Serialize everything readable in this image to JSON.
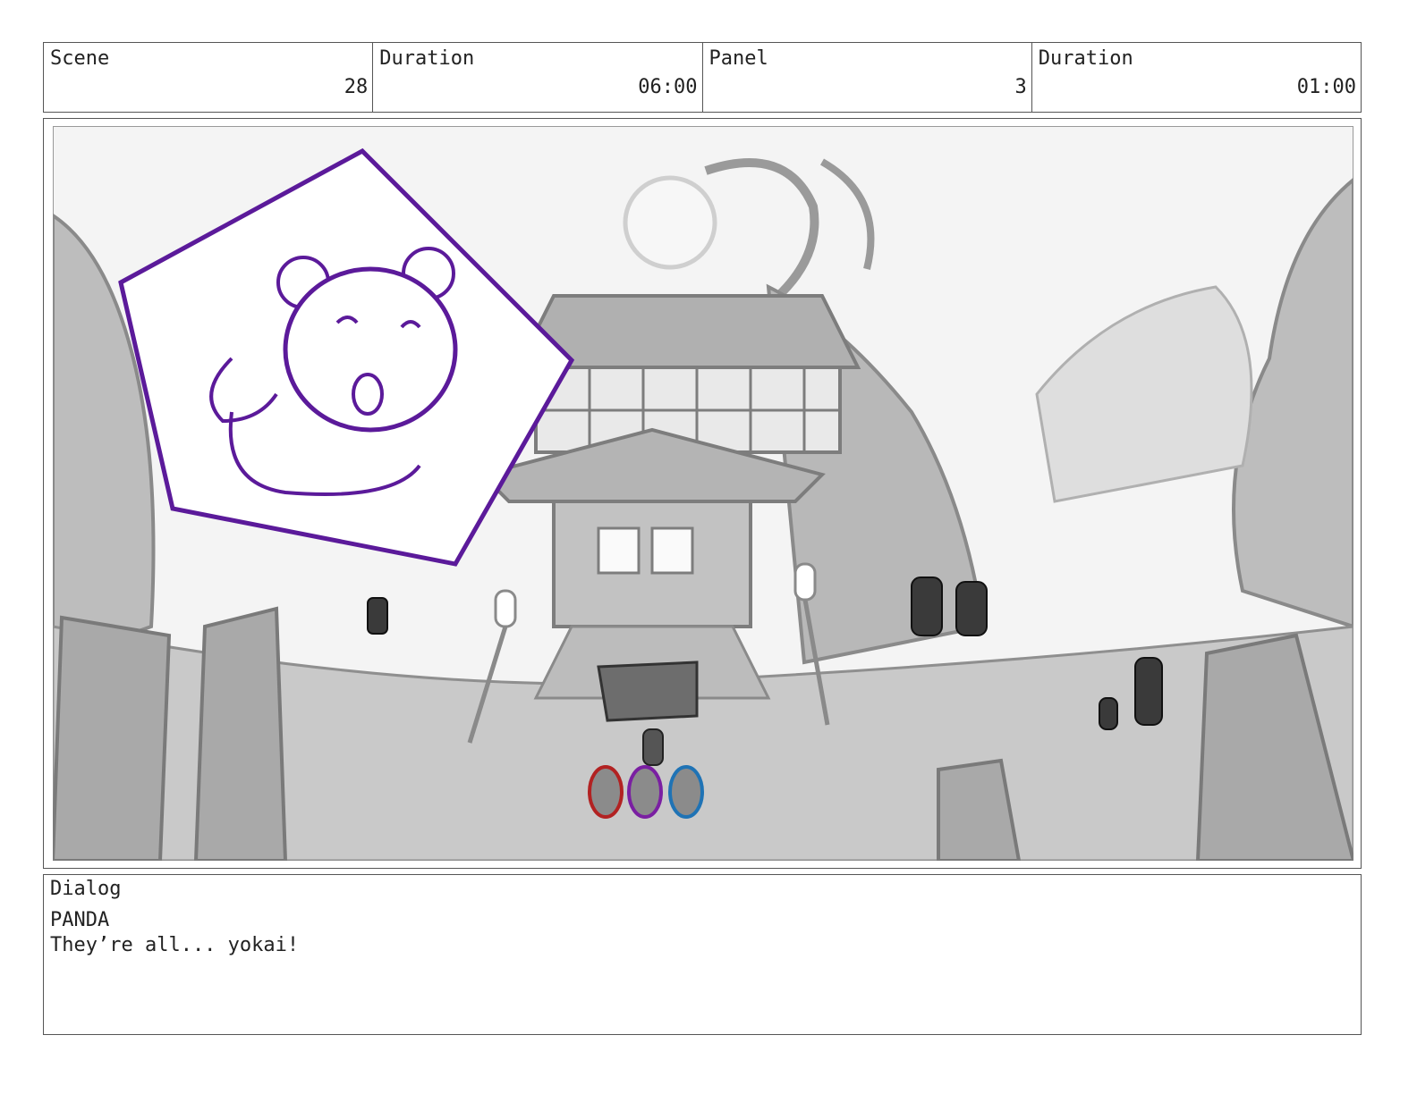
{
  "header": {
    "scene_label": "Scene",
    "scene_value": "28",
    "scene_duration_label": "Duration",
    "scene_duration_value": "06:00",
    "panel_label": "Panel",
    "panel_value": "3",
    "panel_duration_label": "Duration",
    "panel_duration_value": "01:00"
  },
  "panel_art": {
    "description_icons": [
      "moon-icon",
      "shrine-building-icon",
      "panda-inset-icon",
      "character-group-icon"
    ],
    "colors": {
      "inset_outline": "#5b1a9a",
      "character_red": "#b22222",
      "character_purple": "#7a1fa2",
      "character_blue": "#1f73b5",
      "background_gray": "#c8c8c8"
    }
  },
  "dialog": {
    "label": "Dialog",
    "speaker": "PANDA",
    "line": "They’re all... yokai!"
  }
}
